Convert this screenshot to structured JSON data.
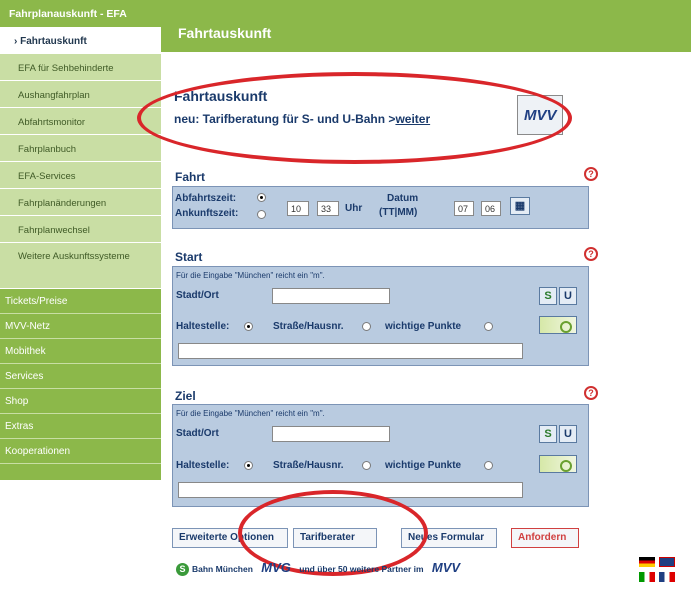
{
  "sidebar": {
    "header": "Fahrplanauskunft - EFA",
    "sub_items": [
      {
        "label": "› Fahrtauskunft",
        "active": true
      },
      {
        "label": "EFA für Sehbehinderte"
      },
      {
        "label": "Aushangfahrplan"
      },
      {
        "label": "Abfahrtsmonitor"
      },
      {
        "label": "Fahrplanbuch"
      },
      {
        "label": "EFA-Services"
      },
      {
        "label": "Fahrplanänderungen"
      },
      {
        "label": "Fahrplanwechsel"
      },
      {
        "label": "Weitere Auskunftssysteme"
      }
    ],
    "main_items": [
      "Tickets/Preise",
      "MVV-Netz",
      "Mobithek",
      "Services",
      "Shop",
      "Extras",
      "Kooperationen"
    ]
  },
  "header": {
    "title": "Fahrtauskunft"
  },
  "banner": {
    "title": "Fahrtauskunft",
    "text": "neu: Tarifberatung für S- und U-Bahn   >",
    "link": "weiter",
    "logo": "MVV"
  },
  "fahrt": {
    "title": "Fahrt",
    "departure_label": "Abfahrtszeit:",
    "arrival_label": "Ankunftszeit:",
    "hour": "10",
    "minute": "33",
    "uhr_label": "Uhr",
    "date_label": "Datum",
    "date_format": "(TT|MM)",
    "day": "07",
    "month": "06"
  },
  "start": {
    "title": "Start",
    "hint": "Für die Eingabe \"München\" reicht ein \"m\".",
    "city_label": "Stadt/Ort",
    "stop_label": "Haltestelle:",
    "street_label": "Straße/Hausnr.",
    "poi_label": "wichtige Punkte",
    "s_btn": "S",
    "u_btn": "U"
  },
  "ziel": {
    "title": "Ziel",
    "hint": "Für die Eingabe \"München\" reicht ein \"m\".",
    "city_label": "Stadt/Ort",
    "stop_label": "Haltestelle:",
    "street_label": "Straße/Hausnr.",
    "poi_label": "wichtige Punkte",
    "s_btn": "S",
    "u_btn": "U"
  },
  "help_icon": "?",
  "tabs": {
    "options": "Erweiterte Optionen",
    "tarif": "Tarifberater",
    "new_form": "Neues Formular",
    "request": "Anfordern"
  },
  "partners": {
    "sbahn_icon": "S",
    "sbahn": "Bahn München",
    "mvg": "MVG",
    "text": "und über 50 weitere Partner im",
    "logo": "MVV"
  },
  "colors": {
    "green": "#8cb84a",
    "light_green": "#c2d99a",
    "panel_blue": "#b9cbe0",
    "navy": "#1a3a6b",
    "red": "#d9262a"
  }
}
